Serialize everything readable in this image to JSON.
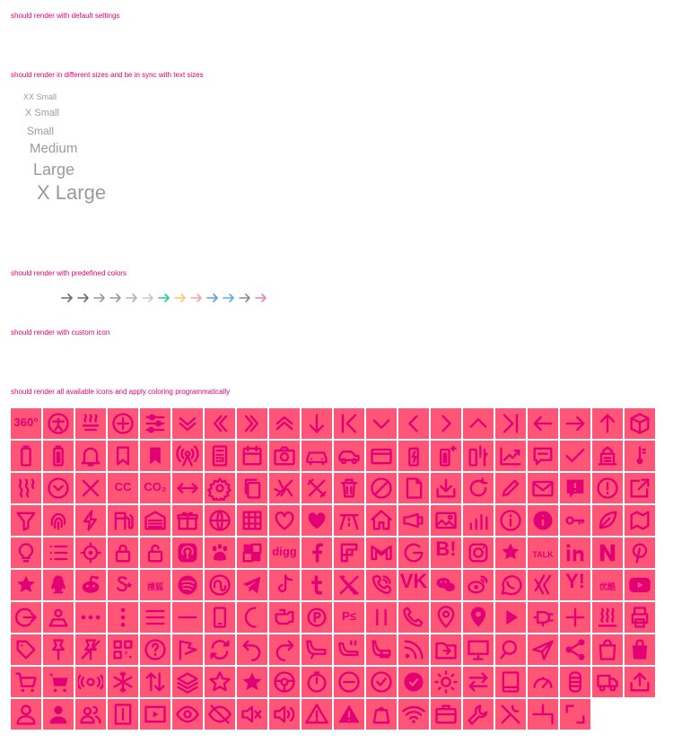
{
  "sections": {
    "default_settings": "should render with default settings",
    "sizes": "should render in different sizes and be in sync with text sizes",
    "predefined_colors": "should render with predefined colors",
    "custom_icon": "should render with custom icon",
    "all_icons": "should render all available icons and apply coloring programmatically"
  },
  "size_labels": [
    "XX Small",
    "X Small",
    "Small",
    "Medium",
    "Large",
    "X Large"
  ],
  "colors": {
    "accent": "#e20074",
    "icon_cell_bg": "#ff5577",
    "size_text": "#9a9a9a",
    "arrow_colors": [
      "#6b6b6b",
      "#6b6b6b",
      "#9a9a9a",
      "#9a9a9a",
      "#b3b3b3",
      "#c8c8c8",
      "#26c9a5",
      "#f7c96b",
      "#f5a5a5",
      "#5a9ee0",
      "#5aaee6",
      "#8a8a8a",
      "#f07cb0"
    ]
  },
  "icon_text": {
    "i360": "360°",
    "cc": "CC",
    "co2": "CO₂",
    "digg": "digg",
    "gb": "B!",
    "talk": "TALK",
    "sohu": "搜狐",
    "youku": "优酷",
    "yahoo": "Y!",
    "vk": "VK",
    "pe": "P≤"
  },
  "icons": [
    [
      "360",
      "accessibility",
      "ac",
      "add-circle",
      "adjust",
      "double-chevron-down",
      "double-chevron-left",
      "double-chevron-right",
      "double-chevron-up",
      "arrow-down",
      "arrow-first",
      "chevron-down",
      "chevron-left",
      "chevron-right",
      "chevron-up",
      "arrow-last",
      "arrow-left",
      "arrow-right",
      "arrow-up",
      "ar"
    ],
    [
      "battery-empty",
      "battery-full",
      "bell",
      "bookmark",
      "bookmark-filled",
      "broadcast",
      "calculator",
      "calendar",
      "camera",
      "car",
      "car-side",
      "card",
      "battery-charging",
      "battery-plus",
      "battery-fault",
      "chart-up",
      "chat",
      "check",
      "castle",
      "thermometer"
    ],
    [
      "heat",
      "clock",
      "close",
      "cc",
      "co2",
      "arrows-horizontal",
      "settings",
      "copy",
      "cut",
      "tools",
      "delete",
      "block",
      "document",
      "download",
      "refresh",
      "edit",
      "mail",
      "alert-bubble",
      "alert-circle",
      "external-link"
    ],
    [
      "filter",
      "fingerprint",
      "flash",
      "fuel",
      "garage",
      "gift",
      "globe",
      "grid",
      "heart",
      "heart-filled",
      "highway",
      "home",
      "horn",
      "image",
      "chart-bars",
      "info",
      "info-filled",
      "key",
      "leaf",
      "map"
    ],
    [
      "lightbulb",
      "list",
      "location-target",
      "lock",
      "unlock",
      "podcast",
      "baidu",
      "delicious",
      "digg",
      "facebook",
      "flipboard",
      "gmail",
      "google",
      "hatena",
      "instagram",
      "kakao",
      "kakaotalk",
      "linkedin",
      "newsgator",
      "pinterest"
    ],
    [
      "qzone",
      "qq",
      "reddit",
      "skyrock",
      "sohu",
      "spotify",
      "stumbleupon",
      "telegram",
      "tiktok",
      "tumblr",
      "x",
      "viber",
      "vk",
      "wechat",
      "weibo",
      "whatsapp",
      "xing",
      "yahoo",
      "youku",
      "youtube"
    ],
    [
      "logout",
      "person-outline",
      "more-horizontal",
      "more-vertical",
      "menu",
      "minus",
      "phone-device",
      "moon",
      "car-engine",
      "parking",
      "parking-ev",
      "pause",
      "phone",
      "pin",
      "pin-filled",
      "play",
      "plug",
      "plus",
      "heater",
      "print"
    ],
    [
      "tag",
      "pushpin",
      "unpin",
      "qr",
      "question",
      "flag",
      "sync",
      "undo",
      "redo",
      "car-seat",
      "car-seat-heat",
      "seat",
      "rss",
      "folder",
      "monitor",
      "search",
      "send",
      "share",
      "bag",
      "bag-filled"
    ],
    [
      "cart",
      "cart-filled",
      "sensor",
      "snow",
      "sort",
      "layers",
      "star",
      "star-filled",
      "steering",
      "timer",
      "remove-circle",
      "check-circle",
      "check-circle-filled",
      "sun",
      "swap",
      "tablet",
      "speedometer",
      "tire",
      "truck",
      "upload"
    ],
    [
      "user",
      "user-filled",
      "users",
      "id",
      "video",
      "eye",
      "eye-off",
      "volume-off",
      "volume",
      "warning",
      "warning-filled",
      "weight",
      "wifi",
      "briefcase",
      "wrench",
      "tools-cross",
      "crop-corner",
      "fullscreen-corner"
    ]
  ]
}
